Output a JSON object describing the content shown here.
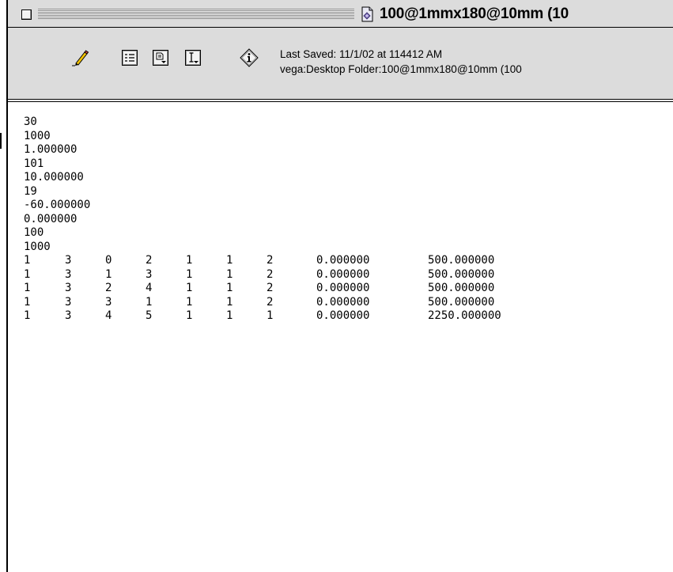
{
  "window": {
    "title": "100@1mmx180@10mm (10",
    "title_icon": "document-script-icon"
  },
  "toolbar": {
    "tools": [
      {
        "name": "pencil-icon"
      },
      {
        "name": "list-icon"
      },
      {
        "name": "page-icon"
      },
      {
        "name": "text-cursor-icon"
      },
      {
        "name": "info-icon"
      }
    ],
    "last_saved": "Last Saved: 11/1/02 at 114412 AM",
    "path": "vega:Desktop Folder:100@1mmx180@10mm (100"
  },
  "document": {
    "lines": [
      "30",
      "1000",
      "1.000000",
      "101",
      "10.000000",
      "19",
      "-60.000000",
      "0.000000",
      "100",
      "1000"
    ],
    "table_rows": [
      [
        "1",
        "3",
        "0",
        "2",
        "1",
        "1",
        "2",
        "0.000000",
        "500.000000"
      ],
      [
        "1",
        "3",
        "1",
        "3",
        "1",
        "1",
        "2",
        "0.000000",
        "500.000000"
      ],
      [
        "1",
        "3",
        "2",
        "4",
        "1",
        "1",
        "2",
        "0.000000",
        "500.000000"
      ],
      [
        "1",
        "3",
        "3",
        "1",
        "1",
        "1",
        "2",
        "0.000000",
        "500.000000"
      ],
      [
        "1",
        "3",
        "4",
        "5",
        "1",
        "1",
        "1",
        "0.000000",
        "2250.000000"
      ]
    ]
  },
  "colors": {
    "chrome": "#dcdcdc",
    "text": "#000000",
    "background": "#ffffff"
  }
}
